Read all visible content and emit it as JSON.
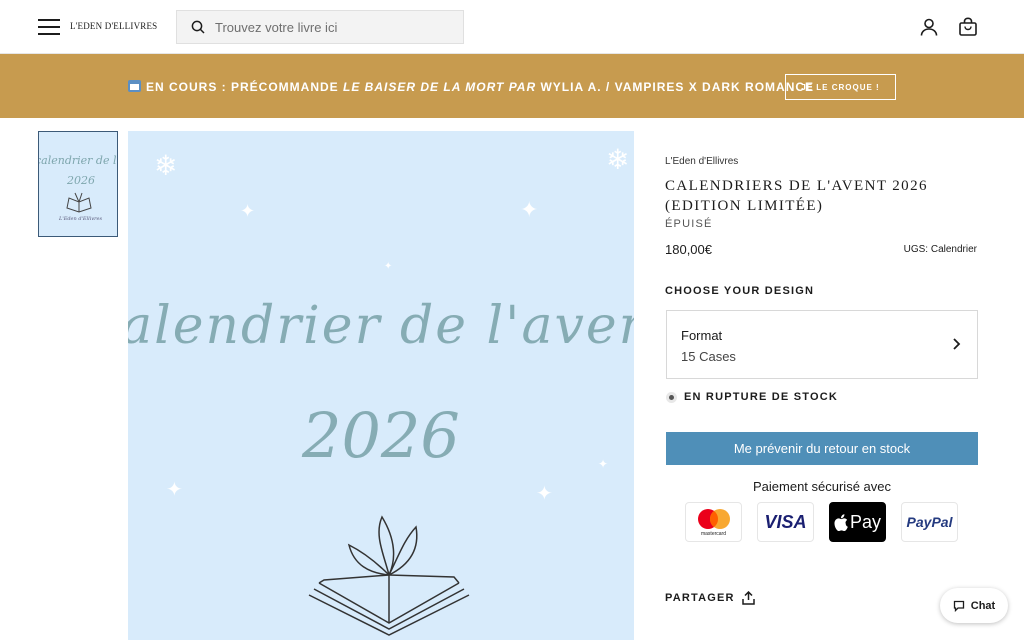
{
  "header": {
    "logo": "L'EDEN D'ELLIVRES",
    "search_placeholder": "Trouvez votre livre ici"
  },
  "banner": {
    "text_prefix": "EN COURS : PRÉCOMMANDE ",
    "text_italic": "LE BAISER DE LA MORT PAR",
    "text_suffix": " WYLIA A. / VAMPIRES X DARK ROMANCE",
    "button": "JE LE CROQUE !"
  },
  "gallery": {
    "image_line1": "calendrier de l'avent",
    "image_line2": "2026",
    "thumb_caption": "L'Eden d'Ellivres"
  },
  "product": {
    "vendor": "L'Eden d'Ellivres",
    "title": "CALENDRIERS DE L'AVENT 2026 (EDITION LIMITÉE)",
    "status": "ÉPUISÉ",
    "price": "180,00€",
    "ugs_label": "UGS:",
    "ugs_value": "Calendrier",
    "choose_design": "CHOOSE YOUR DESIGN",
    "format_label": "Format",
    "format_value": "15 Cases",
    "stock_status": "EN RUPTURE DE STOCK",
    "notify_button": "Me prévenir du retour en stock",
    "payment_title": "Paiement sécurisé avec",
    "payment_methods": {
      "mastercard": "mastercard",
      "visa": "VISA",
      "applepay": "Pay",
      "paypal": "PayPal"
    },
    "share": "PARTAGER"
  },
  "chat": {
    "label": "Chat"
  },
  "colors": {
    "banner": "#c79b4f",
    "button": "#4f8fb8",
    "image_bg": "#d8ebfb"
  },
  "icons": [
    "menu-icon",
    "search-icon",
    "account-icon",
    "cart-icon",
    "calendar-icon",
    "chevron-right-icon",
    "share-icon",
    "chat-bubble-icon"
  ]
}
